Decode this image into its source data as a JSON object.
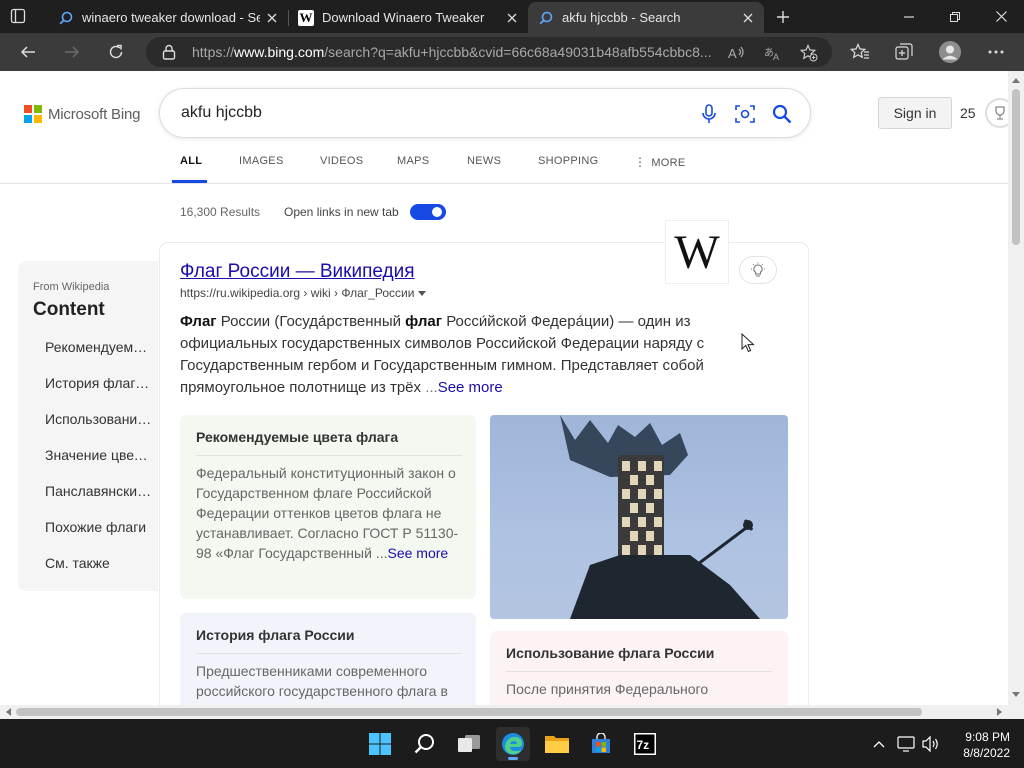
{
  "browser": {
    "tabs": [
      {
        "title": "winaero tweaker download - Sea",
        "icon": "search-icon"
      },
      {
        "title": "Download Winaero Tweaker",
        "icon": "wikipedia-w-icon"
      },
      {
        "title": "akfu hjccbb - Search",
        "icon": "search-icon",
        "active": true
      }
    ],
    "address": {
      "prefix": "https://",
      "host": "www.bing.com",
      "path": "/search?q=akfu+hjccbb&cvid=66c68a49031b48afb554cbbc8..."
    }
  },
  "bing": {
    "logo_text": "Microsoft Bing",
    "logo_colors": [
      "#f25022",
      "#7fba00",
      "#00a4ef",
      "#ffb900"
    ],
    "query": "akfu hjccbb",
    "sign_in": "Sign in",
    "points": "25",
    "scopes": [
      "ALL",
      "IMAGES",
      "VIDEOS",
      "MAPS",
      "NEWS",
      "SHOPPING",
      "MORE"
    ],
    "results_count": "16,300 Results",
    "open_links_label": "Open links in new tab",
    "open_links_on": true,
    "accent": "#174ae4"
  },
  "toc": {
    "from": "From Wikipedia",
    "heading": "Content",
    "items": [
      "Рекомендуемые цвета флага",
      "История флага России",
      "Использование флага России",
      "Значение цветов",
      "Панславянские цвета",
      "Похожие флаги",
      "См. также"
    ]
  },
  "result": {
    "title": "Флаг России — Википедия",
    "url": "https://ru.wikipedia.org › wiki › Флаг_России",
    "logo_letter": "W",
    "snippet_b1": "Флаг",
    "snippet_t1": " России (Госуда́рственный ",
    "snippet_b2": "флаг",
    "snippet_t2": " Росси́йской Федера́ции) — один из официальных государственных символов Российской Федерации наряду с Государственным гербом и Государственным гимном. Представляет собой прямоугольное полотнище из трёх",
    "ellipsis": " ...",
    "see_more": "See more",
    "sections": [
      {
        "heading": "Рекомендуемые цвета флага",
        "body": "Федеральный конституционный закон о Государственном флаге Российской Федерации оттенков цветов флага не устанавливает. Согласно ГОСТ Р 51130-98 «Флаг Государственный",
        "ellipsis": " ...",
        "see_more": "See more"
      },
      {
        "heading": "История флага России",
        "body": "Предшественниками современного российского государственного флага в"
      },
      {
        "heading": "Использование флага России",
        "body": "После принятия Федерального"
      }
    ]
  },
  "taskbar": {
    "time": "9:08 PM",
    "date": "8/8/2022",
    "apps": [
      "windows-start-icon",
      "search-icon",
      "task-view-icon",
      "edge-icon",
      "file-explorer-icon",
      "store-icon",
      "7zip-icon"
    ]
  }
}
